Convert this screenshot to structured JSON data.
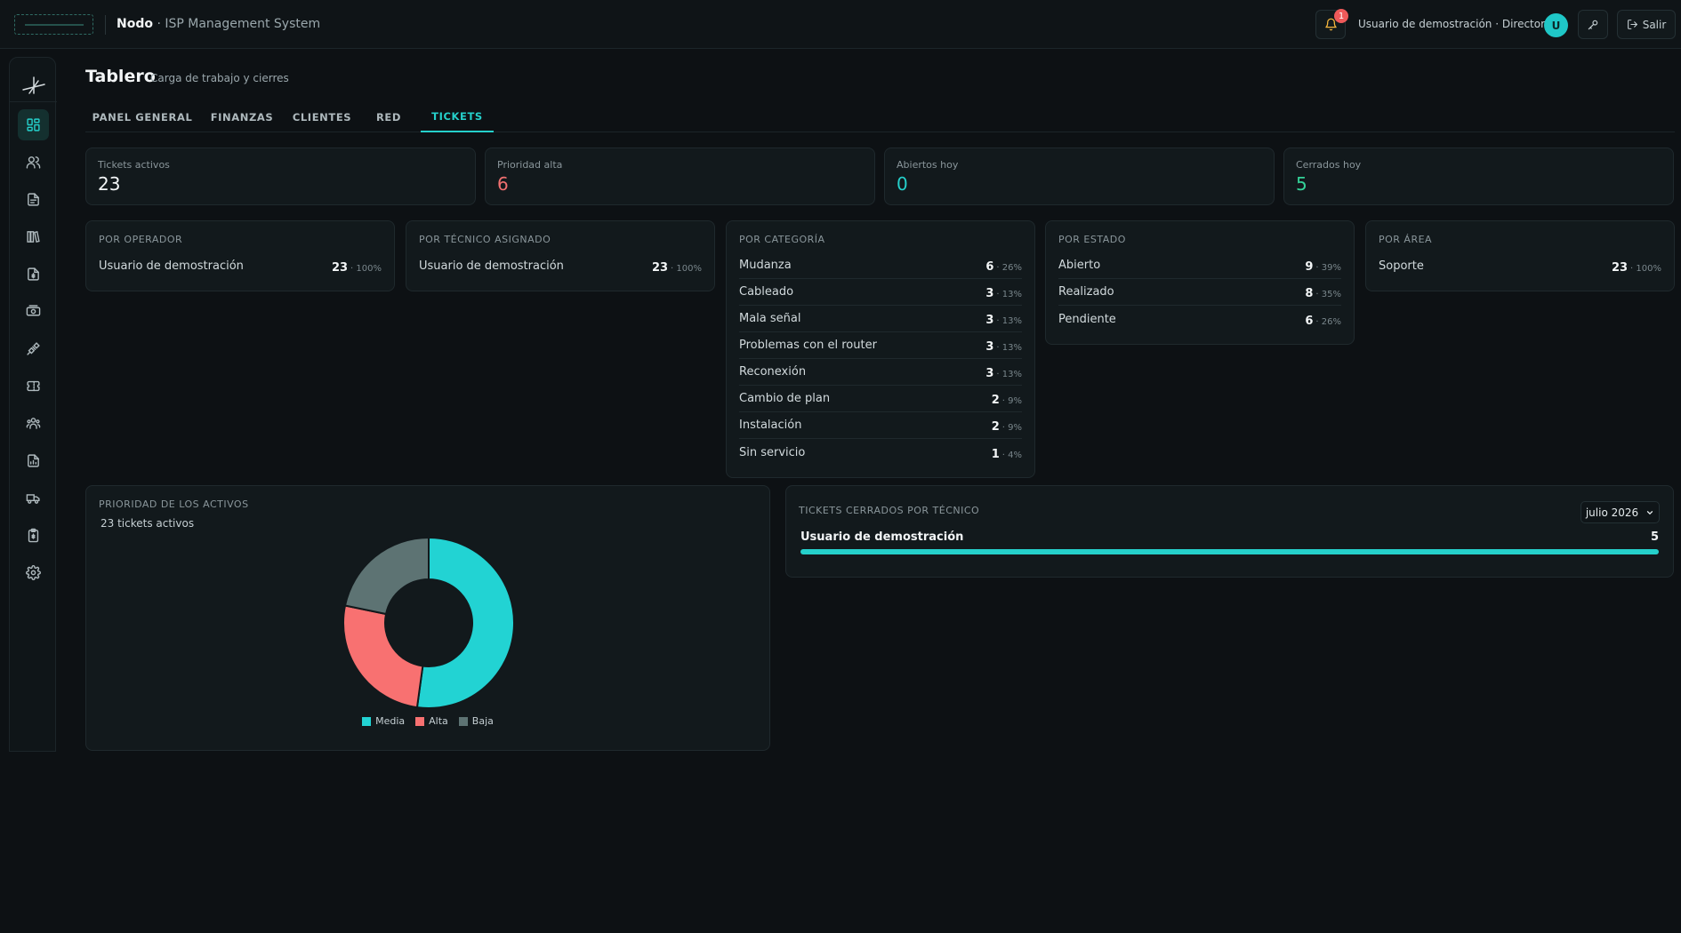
{
  "colors": {
    "accent": "#25d0cb",
    "danger": "#f07070",
    "success": "#34d399",
    "muted_slice": "#5d7373"
  },
  "header": {
    "brand_name": "Nodo",
    "brand_tagline": "· ISP Management System",
    "notifications_count": "1",
    "user_label": "Usuario de demostración · Director",
    "avatar_initial": "U",
    "logout_label": "Salir"
  },
  "sidebar": {
    "items": [
      {
        "icon": "dashboard-icon",
        "active": true
      },
      {
        "icon": "users-icon"
      },
      {
        "icon": "document-icon"
      },
      {
        "icon": "library-icon"
      },
      {
        "icon": "invoice-icon"
      },
      {
        "icon": "money-icon"
      },
      {
        "icon": "satellite-icon"
      },
      {
        "icon": "ticket-icon"
      },
      {
        "icon": "team-icon"
      },
      {
        "icon": "report-icon"
      },
      {
        "icon": "truck-icon"
      },
      {
        "icon": "clipboard-icon"
      },
      {
        "icon": "settings-icon"
      }
    ]
  },
  "page": {
    "title": "Tablero",
    "subtitle": "Carga de trabajo y cierres"
  },
  "tabs": [
    {
      "label": "PANEL GENERAL"
    },
    {
      "label": "FINANZAS"
    },
    {
      "label": "CLIENTES"
    },
    {
      "label": "RED"
    },
    {
      "label": "TICKETS",
      "active": true
    }
  ],
  "stats": [
    {
      "label": "Tickets activos",
      "value": "23",
      "color": "#f2f5f6"
    },
    {
      "label": "Prioridad alta",
      "value": "6",
      "color": "#f07070"
    },
    {
      "label": "Abiertos hoy",
      "value": "0",
      "color": "#25d0cb"
    },
    {
      "label": "Cerrados hoy",
      "value": "5",
      "color": "#34d399"
    }
  ],
  "breakdowns": {
    "operador": {
      "title": "Por operador",
      "rows": [
        {
          "name": "Usuario de demostración",
          "count": "23",
          "pct": "· 100%"
        }
      ]
    },
    "tecnico": {
      "title": "Por técnico asignado",
      "rows": [
        {
          "name": "Usuario de demostración",
          "count": "23",
          "pct": "· 100%"
        }
      ]
    },
    "categoria": {
      "title": "Por categoría",
      "rows": [
        {
          "name": "Mudanza",
          "count": "6",
          "pct": "· 26%"
        },
        {
          "name": "Cableado",
          "count": "3",
          "pct": "· 13%"
        },
        {
          "name": "Mala señal",
          "count": "3",
          "pct": "· 13%"
        },
        {
          "name": "Problemas con el router",
          "count": "3",
          "pct": "· 13%"
        },
        {
          "name": "Reconexión",
          "count": "3",
          "pct": "· 13%"
        },
        {
          "name": "Cambio de plan",
          "count": "2",
          "pct": "· 9%"
        },
        {
          "name": "Instalación",
          "count": "2",
          "pct": "· 9%"
        },
        {
          "name": "Sin servicio",
          "count": "1",
          "pct": "· 4%"
        }
      ]
    },
    "estado": {
      "title": "Por estado",
      "rows": [
        {
          "name": "Abierto",
          "count": "9",
          "pct": "· 39%"
        },
        {
          "name": "Realizado",
          "count": "8",
          "pct": "· 35%"
        },
        {
          "name": "Pendiente",
          "count": "6",
          "pct": "· 26%"
        }
      ]
    },
    "area": {
      "title": "Por área",
      "rows": [
        {
          "name": "Soporte",
          "count": "23",
          "pct": "· 100%"
        }
      ]
    }
  },
  "priority_panel": {
    "title": "Prioridad de los activos",
    "subtitle": "23 tickets activos"
  },
  "chart_data": {
    "type": "pie",
    "donut": true,
    "categories": [
      "Media",
      "Alta",
      "Baja"
    ],
    "values": [
      12,
      6,
      5
    ],
    "colors": [
      "#22d3d3",
      "#f87171",
      "#5d7373"
    ],
    "legend": "bottom"
  },
  "closed_panel": {
    "title": "Tickets cerrados por técnico",
    "period": "julio 2026",
    "rows": [
      {
        "name": "Usuario de demostración",
        "count": "5",
        "fraction": 1.0
      }
    ]
  }
}
